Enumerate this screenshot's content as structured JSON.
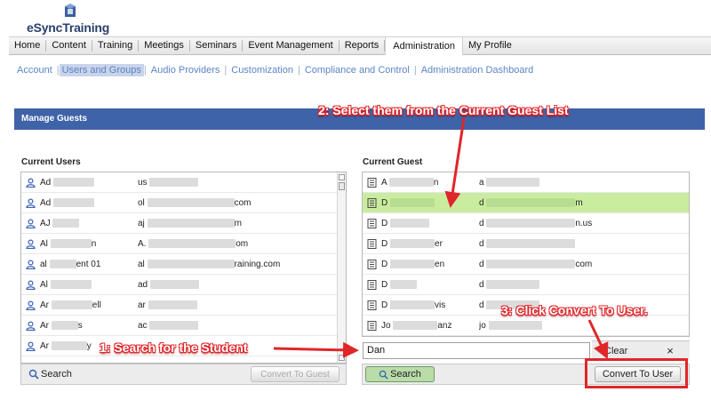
{
  "app": {
    "logo_text": "eSyncTraining"
  },
  "topnav": {
    "items": [
      {
        "label": "Home"
      },
      {
        "label": "Content"
      },
      {
        "label": "Training"
      },
      {
        "label": "Meetings"
      },
      {
        "label": "Seminars"
      },
      {
        "label": "Event Management"
      },
      {
        "label": "Reports"
      },
      {
        "label": "Administration"
      },
      {
        "label": "My Profile"
      }
    ],
    "active": "Administration"
  },
  "subnav": {
    "items": [
      {
        "label": "Account"
      },
      {
        "label": "Users and Groups"
      },
      {
        "label": "Audio Providers"
      },
      {
        "label": "Customization"
      },
      {
        "label": "Compliance and Control"
      },
      {
        "label": "Administration Dashboard"
      }
    ],
    "active": "Users and Groups"
  },
  "page": {
    "title": "Manage Guests"
  },
  "users_panel": {
    "title": "Current Users",
    "rows": [
      {
        "name": "Ad",
        "email": "us"
      },
      {
        "name": "Ad",
        "email": "ol",
        "email_end": "com"
      },
      {
        "name": "AJ",
        "email": "aj",
        "email_end": "m"
      },
      {
        "name": "Al",
        "name_end": "n",
        "email": "A.",
        "email_end": "om"
      },
      {
        "name": "al",
        "name_end": "ent 01",
        "email": "al",
        "email_end": "raining.com"
      },
      {
        "name": "Al",
        "email": "ad"
      },
      {
        "name": "Ar",
        "name_end": "ell",
        "email": "ar"
      },
      {
        "name": "Ar",
        "name_end": "s",
        "email": "ac"
      },
      {
        "name": "Ar",
        "name_end": "y",
        "email": ""
      }
    ],
    "search_label": "Search",
    "convert_label": "Convert To Guest"
  },
  "guests_panel": {
    "title": "Current Guest",
    "rows": [
      {
        "name": "A",
        "name_end": "n",
        "email": "a"
      },
      {
        "name": "D",
        "email": "d",
        "email_end": "m",
        "selected": true
      },
      {
        "name": "D",
        "email": "d",
        "email_end": "n.us"
      },
      {
        "name": "D",
        "name_end": "er",
        "email": "d"
      },
      {
        "name": "D",
        "name_end": "en",
        "email": "d",
        "email_end": "com"
      },
      {
        "name": "D",
        "email": "d"
      },
      {
        "name": "D",
        "name_end": "vis",
        "email": "d"
      },
      {
        "name": "Jo",
        "name_end": "anz",
        "email": "jo"
      }
    ],
    "search_value": "Dan",
    "clear_label": "Clear",
    "close_symbol": "×",
    "search_label": "Search",
    "convert_label": "Convert To User"
  },
  "callouts": {
    "step1": "1: Search for the Student",
    "step2": "2: Select them from the Current Guest List",
    "step3": "3: Click Convert To User."
  },
  "colors": {
    "accent": "#3f63a8",
    "selected_row": "#c9ec9f",
    "callout": "#e0262a",
    "link": "#5b84c7"
  },
  "icons": {
    "user": "user-icon",
    "guest": "guest-icon",
    "search": "magnifier-icon"
  }
}
